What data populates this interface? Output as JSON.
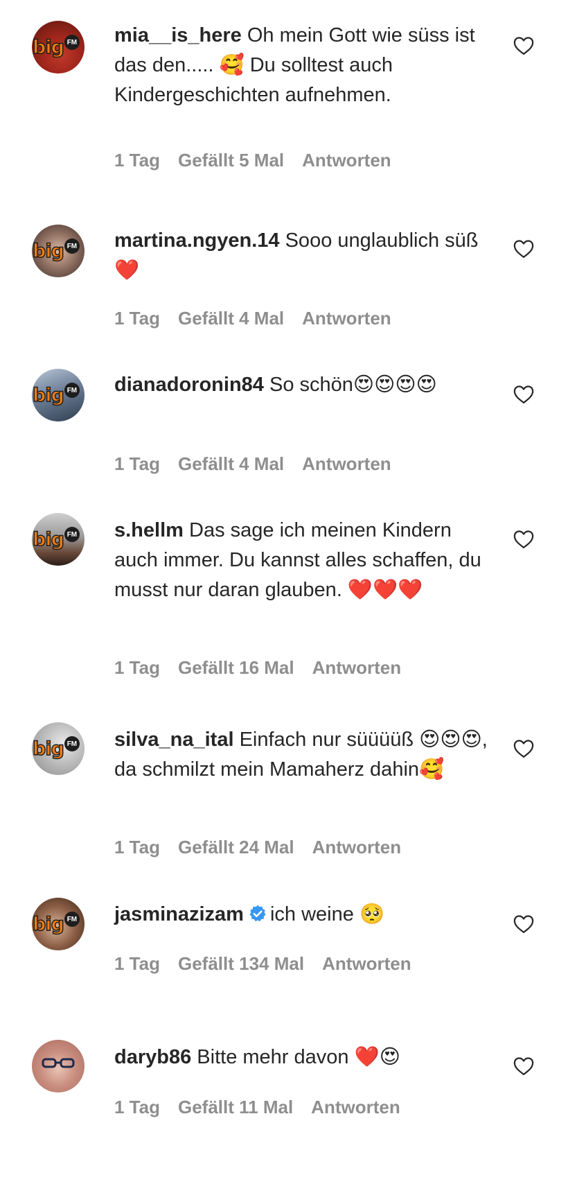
{
  "comments": [
    {
      "username": "mia__is_here",
      "text": "Oh mein Gott wie süss ist das den..... 🥰 Du solltest auch Kindergeschichten aufnehmen.",
      "time": "1 Tag",
      "likes": "Gefällt 5 Mal",
      "reply": "Antworten",
      "avatar_logo": "big",
      "avatar_logo_badge": "FM"
    },
    {
      "username": "martina.ngyen.14",
      "text": "Sooo unglaublich süß❤️",
      "time": "1 Tag",
      "likes": "Gefällt 4 Mal",
      "reply": "Antworten",
      "avatar_logo": "big",
      "avatar_logo_badge": "FM"
    },
    {
      "username": "dianadoronin84",
      "text": "So schön😍😍😍😍",
      "time": "1 Tag",
      "likes": "Gefällt 4 Mal",
      "reply": "Antworten",
      "avatar_logo": "big",
      "avatar_logo_badge": "FM"
    },
    {
      "username": "s.hellm",
      "text": "Das sage ich meinen Kindern auch immer. Du kannst alles schaffen, du musst nur daran glauben. ❤️❤️❤️",
      "time": "1 Tag",
      "likes": "Gefällt 16 Mal",
      "reply": "Antworten",
      "avatar_logo": "big",
      "avatar_logo_badge": "FM"
    },
    {
      "username": "silva_na_ital",
      "text": "Einfach nur süüüüß 😍😍😍, da schmilzt mein Mamaherz dahin🥰",
      "time": "1 Tag",
      "likes": "Gefällt 24 Mal",
      "reply": "Antworten",
      "avatar_logo": "big",
      "avatar_logo_badge": "FM"
    },
    {
      "username": "jasminazizam",
      "text": "ich weine 🥺",
      "time": "1 Tag",
      "likes": "Gefällt 134 Mal",
      "reply": "Antworten",
      "avatar_logo": "big",
      "avatar_logo_badge": "FM",
      "verified": true
    },
    {
      "username": "daryb86",
      "text": "Bitte mehr davon ❤️😍",
      "time": "1 Tag",
      "likes": "Gefällt 11 Mal",
      "reply": "Antworten"
    }
  ],
  "colors": {
    "text": "#262626",
    "meta": "#8e8e8e",
    "logo_orange": "#f07d12",
    "verified_blue": "#3897f0",
    "heart_red": "#e0245e"
  },
  "icons": {
    "like": "heart-outline-icon",
    "verified": "verified-badge-icon"
  }
}
